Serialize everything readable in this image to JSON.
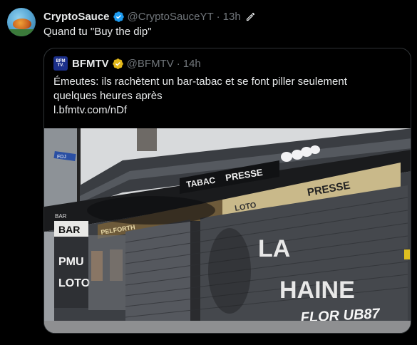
{
  "tweet": {
    "author_name": "CryptoSauce",
    "author_handle": "@CryptoSauceYT",
    "separator": "·",
    "time": "13h",
    "text": "Quand tu \"Buy the dip\""
  },
  "quoted": {
    "logo_text_1": "BFM",
    "logo_text_2": "TV.",
    "author_name": "BFMTV",
    "author_handle": "@BFMTV",
    "separator": "·",
    "time": "14h",
    "text_line_1": "Émeutes: ils rachètent un bar-tabac et se font piller seulement",
    "text_line_2": "quelques heures après",
    "link": "l.bfmtv.com/nDf"
  },
  "photo": {
    "signs": {
      "tabac": "TABAC",
      "presse_top": "PRESSE",
      "presse_right": "PRESSE",
      "loto": "LOTO",
      "pelforth": "PELFORTH",
      "bar_small": "BAR",
      "bar_big": "BAR",
      "pmu": "PMU",
      "loto_left": "LOTO",
      "street": "FDJ",
      "graffiti_la": "LA",
      "graffiti_haine": "HAINE",
      "tag": "FLOR UB87"
    }
  },
  "icons": [
    "verified-badge-icon",
    "edit-pencil-icon"
  ],
  "colors": {
    "background": "#000000",
    "text": "#e7e9ea",
    "secondary": "#71767b",
    "verified": "#1d9bf0",
    "bfm_logo": "#1b2f8a",
    "border": "#2f3336"
  }
}
